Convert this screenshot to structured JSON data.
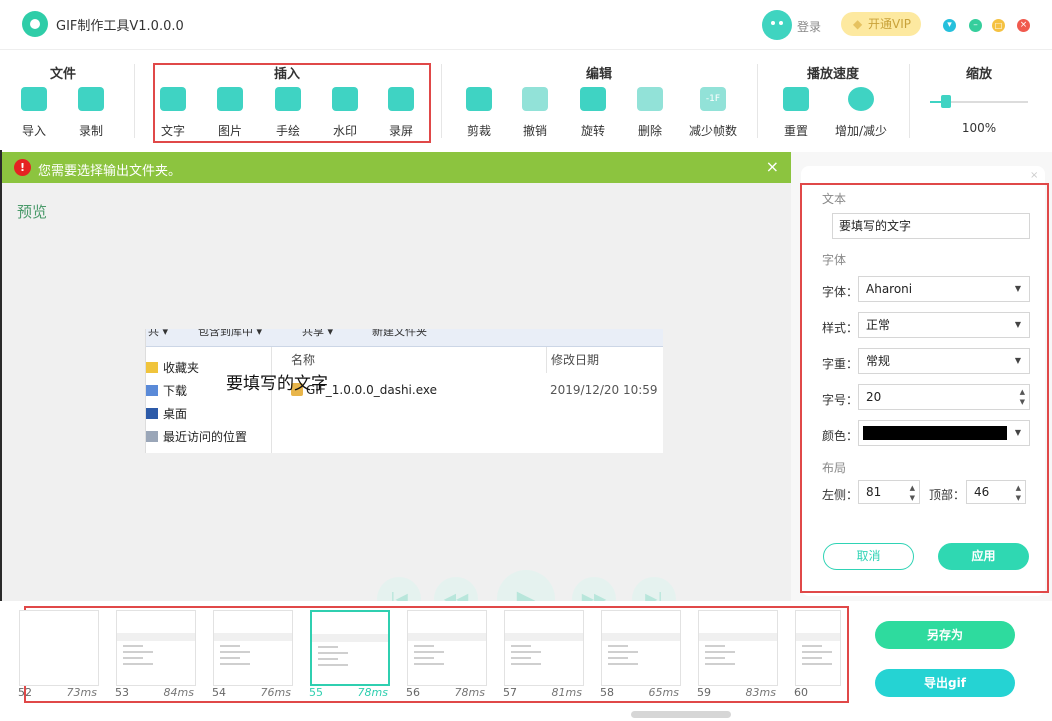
{
  "window": {
    "title": "GIF制作工具V1.0.0.0",
    "login_label": "登录",
    "vip_label": "开通VIP"
  },
  "toolbar": {
    "groups": {
      "file": "文件",
      "insert": "插入",
      "edit": "编辑",
      "speed": "播放速度",
      "zoom": "缩放"
    },
    "tools": {
      "import": "导入",
      "record": "录制",
      "text": "文字",
      "image": "图片",
      "draw": "手绘",
      "watermark": "水印",
      "screen_record": "录屏",
      "crop": "剪裁",
      "undo": "撤销",
      "rotate": "旋转",
      "delete": "删除",
      "reduce_frames": "减少帧数",
      "reset": "重置",
      "speed_adjust": "增加/减少"
    },
    "zoom_value": "100%",
    "zoom_fraction": 0.15,
    "reduce_icon_text": "-1F"
  },
  "notice": {
    "text": "您需要选择输出文件夹。",
    "icon": "!",
    "close": "×"
  },
  "preview": {
    "label": "预览",
    "overlay_text": "要填写的文字",
    "explorer": {
      "toolbar_items": [
        "共 ▾",
        "包含到库中 ▾",
        "共享 ▾",
        "新建文件夹"
      ],
      "nav_items": [
        "收藏夹",
        "下载",
        "桌面",
        "最近访问的位置"
      ],
      "col_name": "名称",
      "col_date": "修改日期",
      "file_name": "GIF_1.0.0.0_dashi.exe",
      "file_date": "2019/12/20 10:59"
    }
  },
  "panel": {
    "section_text": "文本",
    "text_value": "要填写的文字",
    "section_font": "字体",
    "font_label": "字体：",
    "font_value": "Aharoni",
    "style_label": "样式：",
    "style_value": "正常",
    "weight_label": "字重：",
    "weight_value": "常规",
    "size_label": "字号：",
    "size_value": "20",
    "color_label": "颜色：",
    "color_value": "#000000",
    "section_layout": "布局",
    "left_label": "左侧：",
    "left_value": "81",
    "top_label": "顶部：",
    "top_value": "46",
    "cancel": "取消",
    "apply": "应用"
  },
  "timeline": {
    "frames": [
      {
        "num": "52",
        "ms": "73ms"
      },
      {
        "num": "53",
        "ms": "84ms"
      },
      {
        "num": "54",
        "ms": "76ms"
      },
      {
        "num": "55",
        "ms": "78ms"
      },
      {
        "num": "56",
        "ms": "78ms"
      },
      {
        "num": "57",
        "ms": "81ms"
      },
      {
        "num": "58",
        "ms": "65ms"
      },
      {
        "num": "59",
        "ms": "83ms"
      },
      {
        "num": "60",
        "ms": ""
      }
    ],
    "selected_index": 3,
    "save_as": "另存为",
    "export_gif": "导出gif"
  },
  "colors": {
    "accent": "#2fcfb0",
    "notice_bg": "#8cc43f",
    "highlight_border": "#e04848"
  }
}
